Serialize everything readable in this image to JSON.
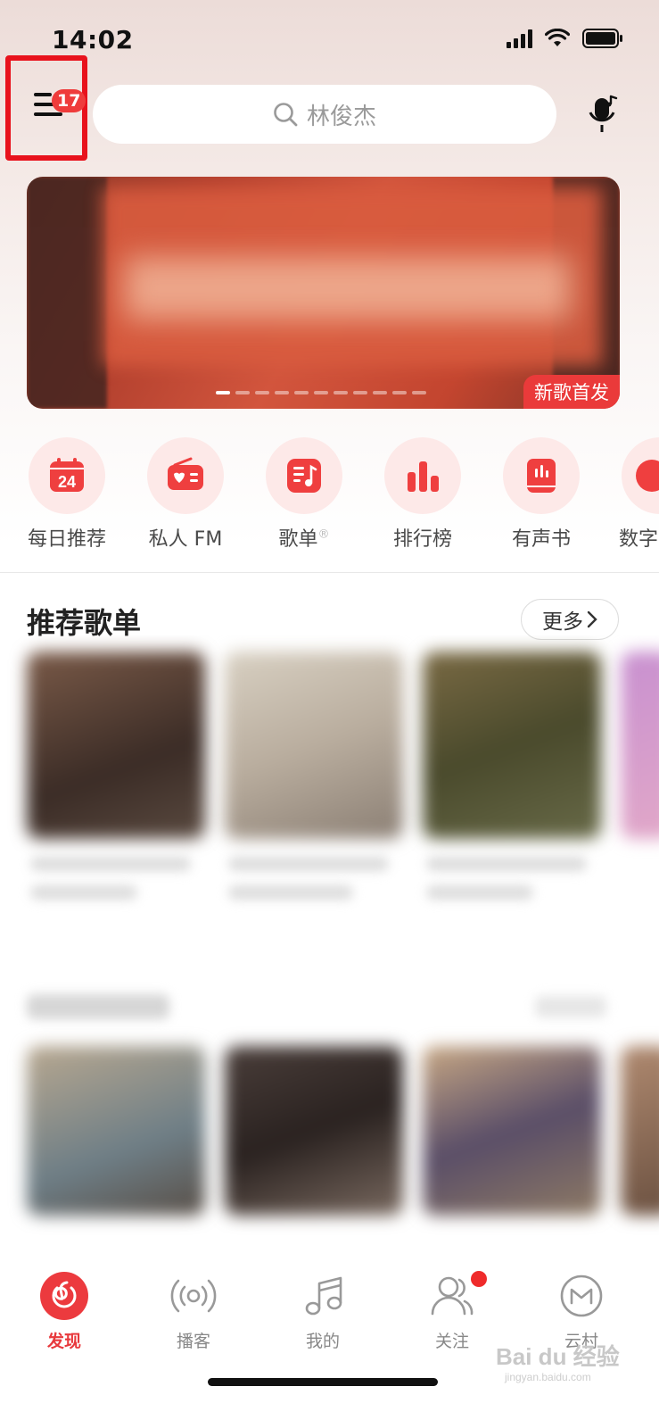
{
  "status_bar": {
    "time": "14:02"
  },
  "header": {
    "badge_count": "17",
    "search_placeholder": "林俊杰"
  },
  "banner": {
    "tag": "新歌首发",
    "dot_count": 11,
    "active_dot": 0
  },
  "quick_links": [
    {
      "label": "每日推荐",
      "icon": "calendar-24-icon",
      "day": "24"
    },
    {
      "label": "私人 FM",
      "icon": "radio-icon"
    },
    {
      "label": "歌单",
      "icon": "playlist-icon",
      "mark": "®"
    },
    {
      "label": "排行榜",
      "icon": "chart-bars-icon"
    },
    {
      "label": "有声书",
      "icon": "audiobook-icon"
    },
    {
      "label": "数字",
      "icon": "digital-icon"
    }
  ],
  "recommended": {
    "title": "推荐歌单",
    "more_label": "更多"
  },
  "tab_bar": {
    "tabs": [
      {
        "label": "发现",
        "icon": "discover-icon",
        "active": true
      },
      {
        "label": "播客",
        "icon": "podcast-icon",
        "active": false
      },
      {
        "label": "我的",
        "icon": "music-note-icon",
        "active": false
      },
      {
        "label": "关注",
        "icon": "follow-icon",
        "active": false,
        "has_dot": true
      },
      {
        "label": "云村",
        "icon": "cloud-village-icon",
        "active": false
      }
    ]
  },
  "watermark": {
    "text": "Bai du 经验",
    "sub": "jingyan.baidu.com"
  },
  "colors": {
    "accent": "#e8383c",
    "highlight_box": "#e8121c",
    "icon_bg": "#fde9e8"
  }
}
